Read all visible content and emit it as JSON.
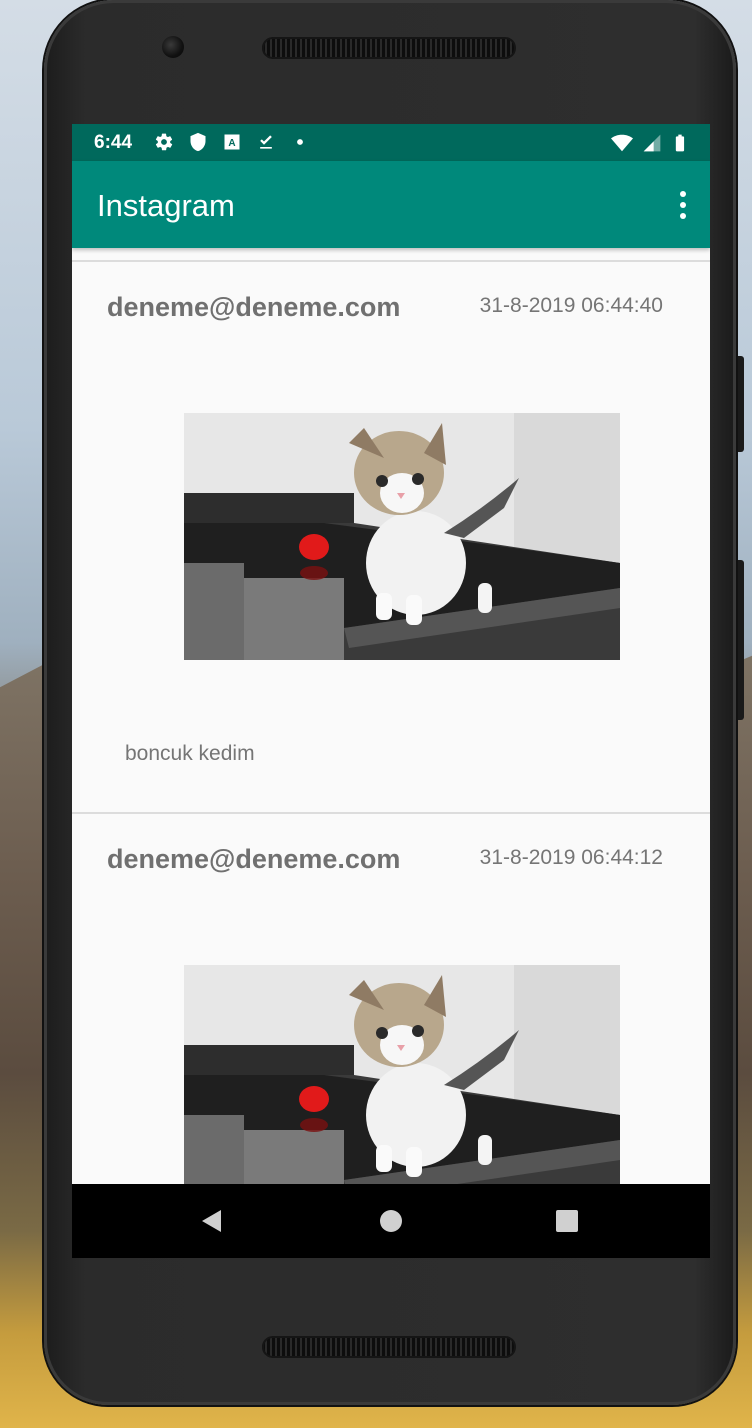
{
  "status_bar": {
    "time": "6:44",
    "icons_left": [
      "settings-icon",
      "shield-icon",
      "translate-icon",
      "download-done-icon",
      "dot-icon"
    ],
    "icons_right": [
      "wifi-icon",
      "signal-icon",
      "battery-icon"
    ]
  },
  "app_bar": {
    "title": "Instagram",
    "menu_icon": "more-vert-icon"
  },
  "posts": [
    {
      "email": "deneme@deneme.com",
      "date": "31-8-2019 06:44:40",
      "caption": "boncuk kedim"
    },
    {
      "email": "deneme@deneme.com",
      "date": "31-8-2019 06:44:12",
      "caption": ""
    }
  ],
  "nav_bar": {
    "buttons": [
      "back-icon",
      "home-icon",
      "recents-icon"
    ]
  },
  "colors": {
    "status_bar": "#00695c",
    "app_bar": "#00897b"
  }
}
